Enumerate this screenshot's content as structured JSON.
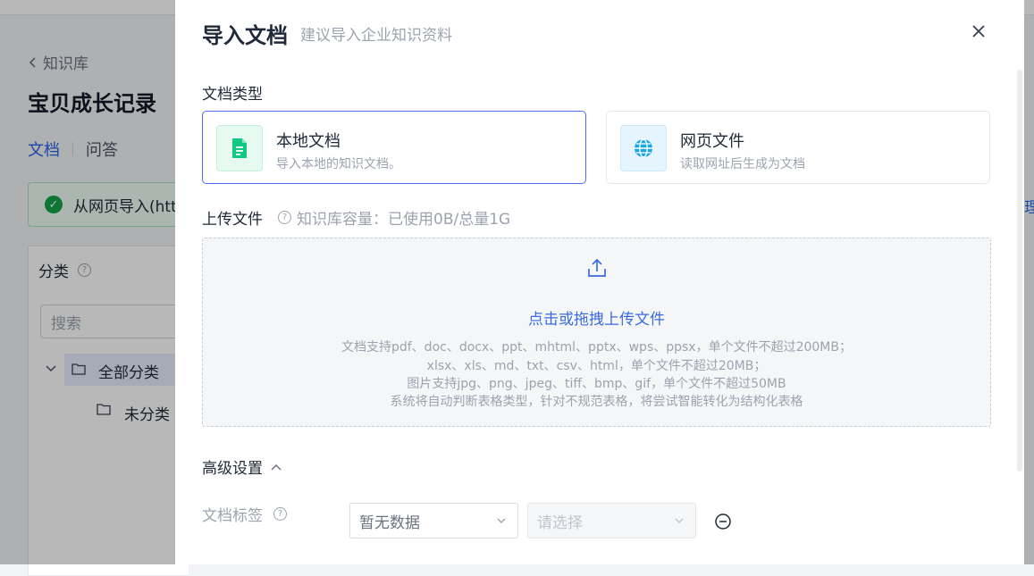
{
  "background": {
    "back_label": "知识库",
    "title": "宝贝成长记录",
    "tabs": [
      {
        "label": "文档",
        "active": true
      },
      {
        "label": "问答",
        "active": false
      }
    ],
    "alert_text": "从网页导入(htt",
    "right_edge_text": "理",
    "panel": {
      "header": "分类",
      "search_placeholder": "搜索",
      "tree": [
        {
          "label": "全部分类",
          "expanded": true,
          "selected": true
        },
        {
          "label": "未分类",
          "expanded": false,
          "selected": false
        }
      ]
    }
  },
  "modal": {
    "title": "导入文档",
    "subtitle": "建议导入企业知识资料",
    "doc_type_label": "文档类型",
    "types": [
      {
        "name": "本地文档",
        "desc": "导入本地的知识文档。",
        "icon": "document-icon",
        "selected": true
      },
      {
        "name": "网页文件",
        "desc": "读取网址后生成为文档",
        "icon": "globe-icon",
        "selected": false
      }
    ],
    "upload": {
      "label": "上传文件",
      "capacity": "知识库容量：已使用0B/总量1G",
      "main_text": "点击或拖拽上传文件",
      "lines": [
        "文档支持pdf、doc、docx、ppt、mhtml、pptx、wps、ppsx，单个文件不超过200MB；",
        "xlsx、xls、md、txt、csv、html，单个文件不超过20MB；",
        "图片支持jpg、png、jpeg、tiff、bmp、gif，单个文件不超过50MB",
        "系统将自动判断表格类型，针对不规范表格，将尝试智能转化为结构化表格"
      ]
    },
    "advanced": {
      "label": "高级设置",
      "expanded": true
    },
    "tags": {
      "label": "文档标签",
      "select1_value": "暂无数据",
      "select2_placeholder": "请选择"
    }
  },
  "colors": {
    "accent": "#3b6be0",
    "active_border": "#4f6ef7",
    "success": "#16a34a",
    "doc_icon_green": "#10c982",
    "globe_icon_blue": "#1aa7e8"
  }
}
